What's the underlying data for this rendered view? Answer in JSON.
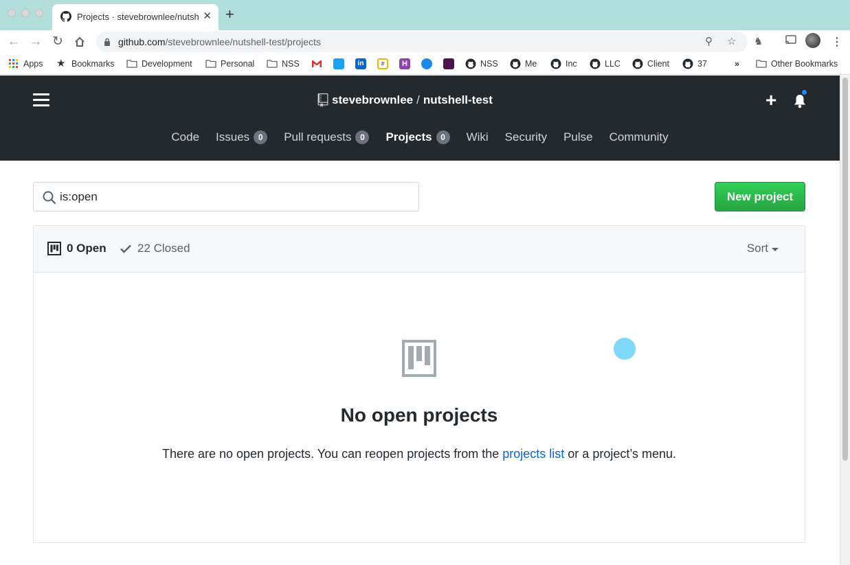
{
  "browser": {
    "tab_title": "Projects · stevebrownlee/nutsh",
    "url_host": "github.com",
    "url_path": "/stevebrownlee/nutshell-test/projects",
    "bookmarks": [
      {
        "label": "Apps",
        "icon": "apps-grid-icon"
      },
      {
        "label": "Bookmarks",
        "icon": "star-icon"
      },
      {
        "label": "Development",
        "icon": "folder-icon"
      },
      {
        "label": "Personal",
        "icon": "folder-icon"
      },
      {
        "label": "NSS",
        "icon": "folder-icon"
      },
      {
        "label": "",
        "icon": "gmail-icon"
      },
      {
        "label": "",
        "icon": "twitter-icon"
      },
      {
        "label": "",
        "icon": "linkedin-icon"
      },
      {
        "label": "",
        "icon": "hashtag-icon"
      },
      {
        "label": "",
        "icon": "h-icon"
      },
      {
        "label": "",
        "icon": "chat-icon"
      },
      {
        "label": "",
        "icon": "slack-icon"
      },
      {
        "label": "NSS",
        "icon": "github-icon"
      },
      {
        "label": "Me",
        "icon": "github-icon"
      },
      {
        "label": "Inc",
        "icon": "github-icon"
      },
      {
        "label": "LLC",
        "icon": "github-icon"
      },
      {
        "label": "Client",
        "icon": "github-icon"
      },
      {
        "label": "37",
        "icon": "github-icon"
      }
    ],
    "more_bookmarks": "»",
    "other_bookmarks": "Other Bookmarks"
  },
  "header": {
    "owner": "stevebrownlee",
    "separator": "/",
    "repo": "nutshell-test",
    "nav": [
      {
        "label": "Code",
        "count": null,
        "selected": false
      },
      {
        "label": "Issues",
        "count": "0",
        "selected": false
      },
      {
        "label": "Pull requests",
        "count": "0",
        "selected": false
      },
      {
        "label": "Projects",
        "count": "0",
        "selected": true
      },
      {
        "label": "Wiki",
        "count": null,
        "selected": false
      },
      {
        "label": "Security",
        "count": null,
        "selected": false
      },
      {
        "label": "Pulse",
        "count": null,
        "selected": false
      },
      {
        "label": "Community",
        "count": null,
        "selected": false
      }
    ]
  },
  "content": {
    "search_value": "is:open",
    "new_project_label": "New project",
    "open_label": "0 Open",
    "closed_label": "22 Closed",
    "sort_label": "Sort",
    "blank_title": "No open projects",
    "blank_text_before": "There are no open projects. You can reopen projects from the ",
    "blank_link": "projects list",
    "blank_text_after": " or a project’s menu."
  },
  "colors": {
    "titlebar": "#b2dfdb",
    "header_bg": "#24292e",
    "primary_button": "#28a745",
    "link": "#0366d6"
  }
}
